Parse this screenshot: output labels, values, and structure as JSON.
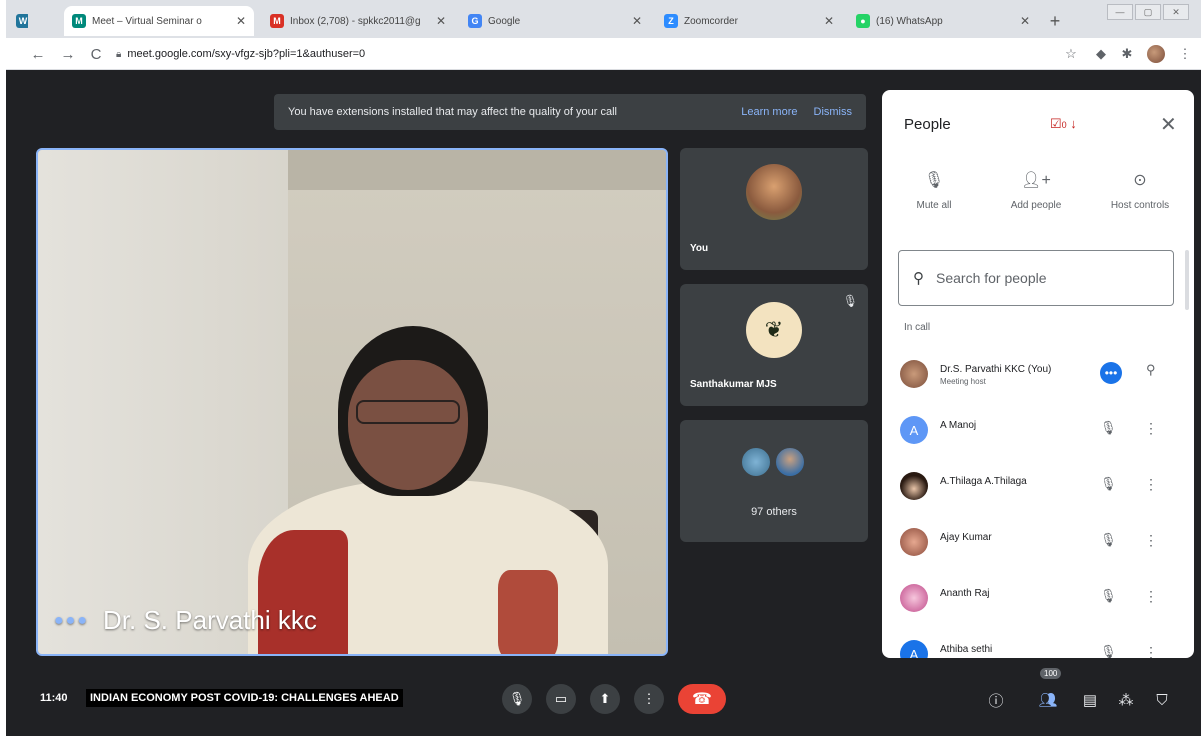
{
  "browser": {
    "tabs": [
      {
        "title": "Meet – Virtual Seminar o",
        "favicon": "meet-icon",
        "color": "#00897b",
        "active": true
      },
      {
        "title": "Inbox (2,708) - spkkc2011@g",
        "favicon": "gmail-icon",
        "color": "#d93025"
      },
      {
        "title": "Google",
        "favicon": "google-icon",
        "color": "#4285f4"
      },
      {
        "title": "Zoomcorder",
        "favicon": "zoomcorder-icon",
        "color": "#2d8cff"
      },
      {
        "title": "(16) WhatsApp",
        "favicon": "whatsapp-icon",
        "color": "#25d366"
      }
    ],
    "url": "meet.google.com/sxy-vfgz-sjb?pli=1&authuser=0"
  },
  "notice": {
    "message": "You have extensions installed that may affect the quality of your call",
    "learn_more": "Learn more",
    "dismiss": "Dismiss"
  },
  "main_video": {
    "speaker_name": "Dr. S. Parvathi kkc"
  },
  "tiles": {
    "you_label": "You",
    "santha_label": "Santhakumar MJS",
    "others_label": "97 others"
  },
  "people_panel": {
    "title": "People",
    "badge_count": "0",
    "actions": {
      "mute_all": "Mute all",
      "add_people": "Add people",
      "host_controls": "Host controls"
    },
    "search_placeholder": "Search for people",
    "section_label": "In call",
    "participants": [
      {
        "name": "Dr.S. Parvathi KKC (You)",
        "sub": "Meeting host",
        "initial": "",
        "avatar_color": "#b07a5a"
      },
      {
        "name": "A Manoj",
        "sub": "",
        "initial": "A",
        "avatar_color": "#5e97f6"
      },
      {
        "name": "A.Thilaga A.Thilaga",
        "sub": "",
        "initial": "",
        "avatar_color": "#6b4a3a"
      },
      {
        "name": "Ajay Kumar",
        "sub": "",
        "initial": "",
        "avatar_color": "#c98a7a"
      },
      {
        "name": "Ananth Raj",
        "sub": "",
        "initial": "",
        "avatar_color": "#d58bb4"
      },
      {
        "name": "Athiba sethi",
        "sub": "",
        "initial": "A",
        "avatar_color": "#1a73e8"
      }
    ]
  },
  "bottom_bar": {
    "time": "11:40",
    "meeting_name": "INDIAN ECONOMY POST COVID-19: CHALLENGES AHEAD",
    "participant_count": "100"
  },
  "colors": {
    "meet_bg": "#202124",
    "tile_bg": "#3c4043",
    "accent": "#8ab4f8",
    "end_call": "#ea4335",
    "button_blue": "#1a73e8"
  }
}
